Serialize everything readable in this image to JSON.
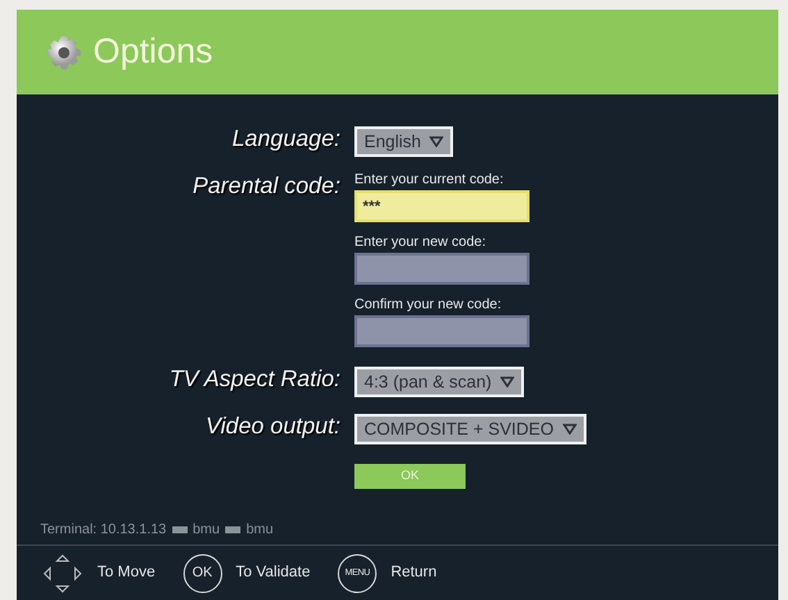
{
  "header": {
    "title": "Options"
  },
  "fields": [
    {
      "kind": "select",
      "label": "Language:",
      "value": "English"
    },
    {
      "kind": "codes",
      "label": "Parental code:",
      "inputs": [
        {
          "caption": "Enter your current code:",
          "value": "***",
          "focused": true
        },
        {
          "caption": "Enter your new code:",
          "focused": false
        },
        {
          "caption": "Confirm your new code:",
          "focused": false
        }
      ]
    },
    {
      "kind": "select",
      "label": "TV Aspect Ratio:",
      "value": "4:3 (pan & scan)"
    },
    {
      "kind": "select",
      "label": "Video output:",
      "value": "COMPOSITE + SVIDEO"
    }
  ],
  "ok_button": "OK",
  "terminal": {
    "label": "Terminal: 10.13.1.13",
    "users": [
      "bmu",
      "bmu"
    ]
  },
  "hints": [
    {
      "kind": "dpad",
      "text": "To Move"
    },
    {
      "kind": "key",
      "key": "OK",
      "text": "To Validate"
    },
    {
      "kind": "key",
      "key": "MENU",
      "text": "Return"
    }
  ]
}
